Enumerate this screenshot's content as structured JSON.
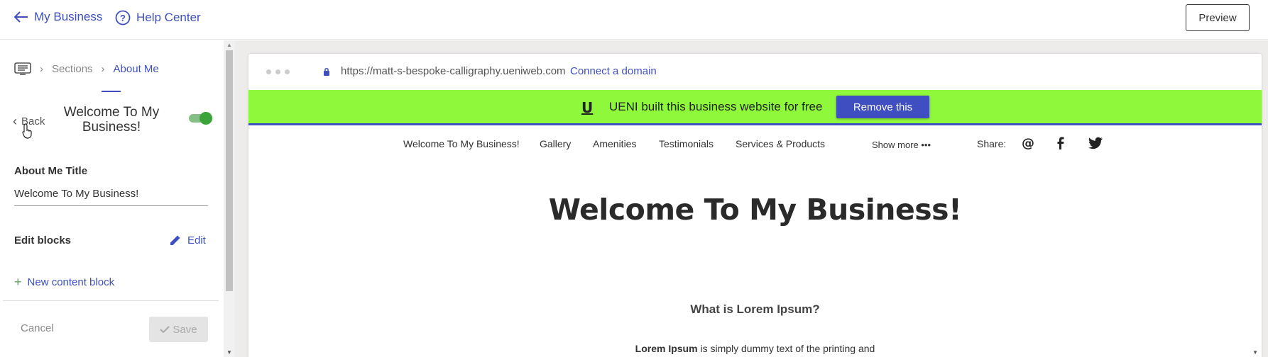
{
  "topbar": {
    "back_label": "My Business",
    "help_label": "Help Center",
    "preview_label": "Preview"
  },
  "breadcrumb": {
    "sections": "Sections",
    "current": "About Me"
  },
  "panel": {
    "back_label": "Back",
    "section_title": "Welcome To My Business!",
    "toggle_on": true,
    "field_label": "About Me Title",
    "field_value": "Welcome To My Business!",
    "edit_blocks_label": "Edit blocks",
    "edit_label": "Edit",
    "new_block_label": "New content block",
    "cancel_label": "Cancel",
    "save_label": "Save"
  },
  "browser": {
    "url": "https://matt-s-bespoke-calligraphy.ueniweb.com",
    "connect_domain": "Connect a domain"
  },
  "banner": {
    "logo": "U",
    "text": "UENI built this business website for free",
    "remove_label": "Remove this"
  },
  "site": {
    "nav": [
      "Welcome To My Business!",
      "Gallery",
      "Amenities",
      "Testimonials",
      "Services & Products"
    ],
    "show_more": "Show more •••",
    "share_label": "Share:",
    "title": "Welcome To My Business!",
    "subheading": "What is Lorem Ipsum?",
    "paragraph_bold": "Lorem Ipsum",
    "paragraph_rest": " is simply dummy text of the printing and"
  },
  "colors": {
    "accent": "#3f4fc2",
    "banner": "#8ff83a",
    "toggle": "#3aa33a"
  },
  "icons": [
    "arrow-left-icon",
    "help-circle-icon",
    "sections-icon",
    "chevron-right-icon",
    "chevron-left-icon",
    "pencil-icon",
    "plus-icon",
    "check-icon",
    "lock-icon",
    "email-icon",
    "facebook-icon",
    "twitter-icon"
  ]
}
